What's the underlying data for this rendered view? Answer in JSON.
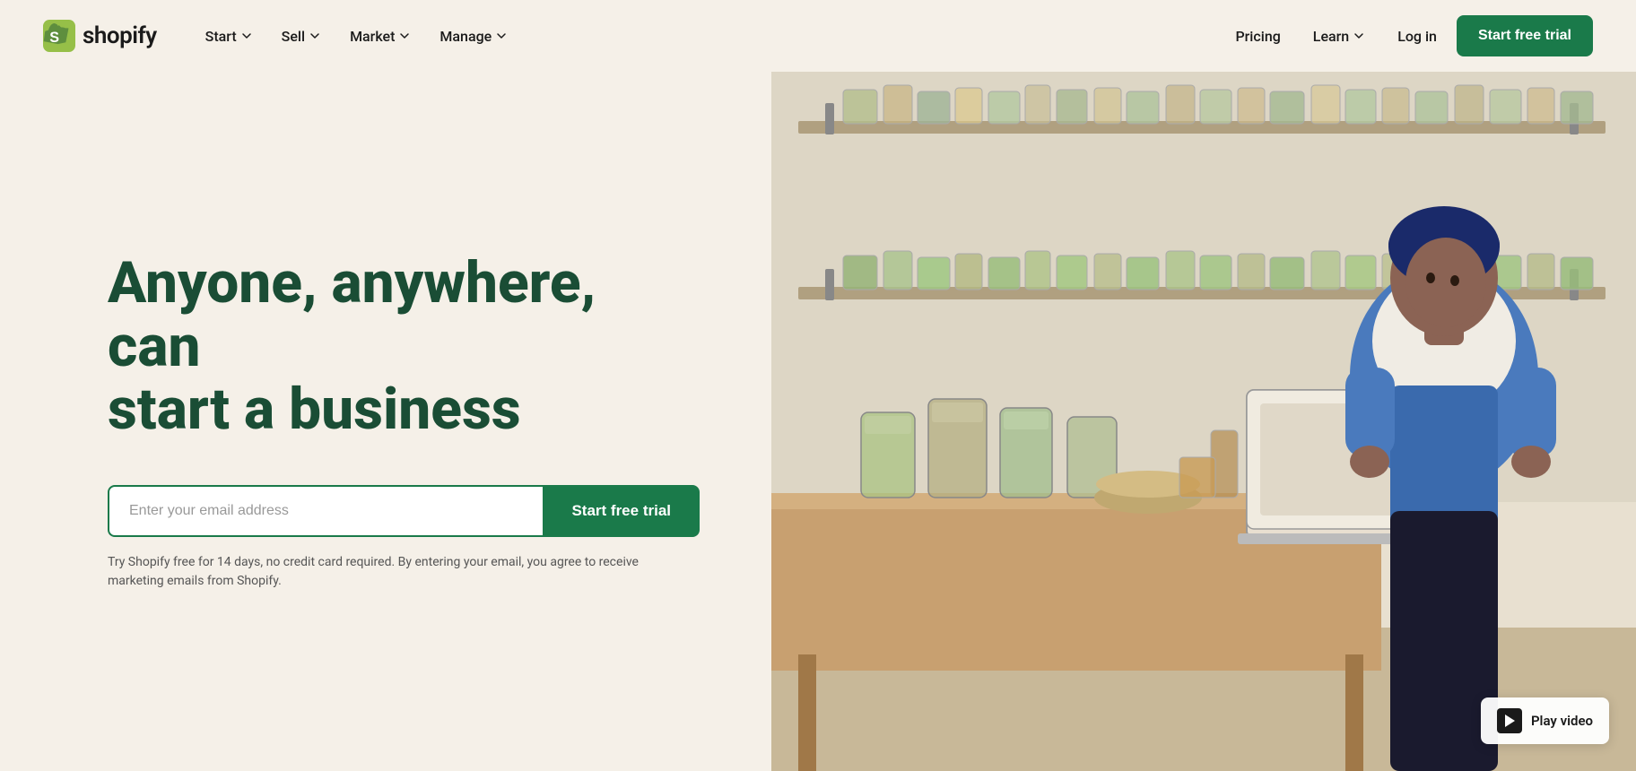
{
  "nav": {
    "logo_text": "shopify",
    "items": [
      {
        "label": "Start",
        "has_dropdown": true
      },
      {
        "label": "Sell",
        "has_dropdown": true
      },
      {
        "label": "Market",
        "has_dropdown": true
      },
      {
        "label": "Manage",
        "has_dropdown": true
      }
    ],
    "right_items": [
      {
        "label": "Pricing",
        "has_dropdown": false
      },
      {
        "label": "Learn",
        "has_dropdown": true
      },
      {
        "label": "Log in",
        "has_dropdown": false
      }
    ],
    "cta_label": "Start free trial"
  },
  "hero": {
    "headline_line1": "Anyone, anywhere, can",
    "headline_line2": "start a business",
    "email_placeholder": "Enter your email address",
    "cta_label": "Start free trial",
    "disclaimer": "Try Shopify free for 14 days, no credit card required. By entering your email, you agree to receive marketing emails from Shopify."
  },
  "play_video": {
    "label": "Play video"
  },
  "colors": {
    "bg": "#f5f0e8",
    "green": "#1a7a4a",
    "dark_green_text": "#1a4d35"
  }
}
